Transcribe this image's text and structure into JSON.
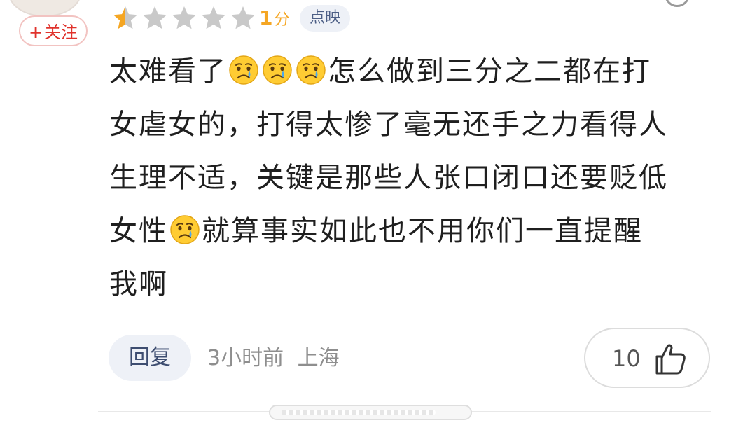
{
  "review": {
    "follow_label": "关注",
    "rating_score": 1,
    "rating_unit": "分",
    "rating_max_stars": 5,
    "rating_filled_fraction": 0.5,
    "star_color": "#f5a623",
    "star_empty_color": "#c9c9c9",
    "source_badge": "点映",
    "content_lines": [
      {
        "pre": "太难看了",
        "emoji_count": 3,
        "post": "怎么做到三分之二都在打"
      },
      {
        "pre": "女虐女的，打得太惨了毫无还手之力看得人",
        "emoji_count": 0,
        "post": ""
      },
      {
        "pre": "生理不适，关键是那些人张口闭口还要贬低",
        "emoji_count": 0,
        "post": ""
      },
      {
        "pre": "女性",
        "emoji_count": 1,
        "post": "就算事实如此也不用你们一直提醒"
      },
      {
        "pre": "我啊",
        "emoji_count": 0,
        "post": ""
      }
    ],
    "emoji_name": "crying-face",
    "reply_label": "回复",
    "time_ago": "3小时前",
    "location": "上海",
    "like_count": "10",
    "accent_red": "#e0322c"
  }
}
